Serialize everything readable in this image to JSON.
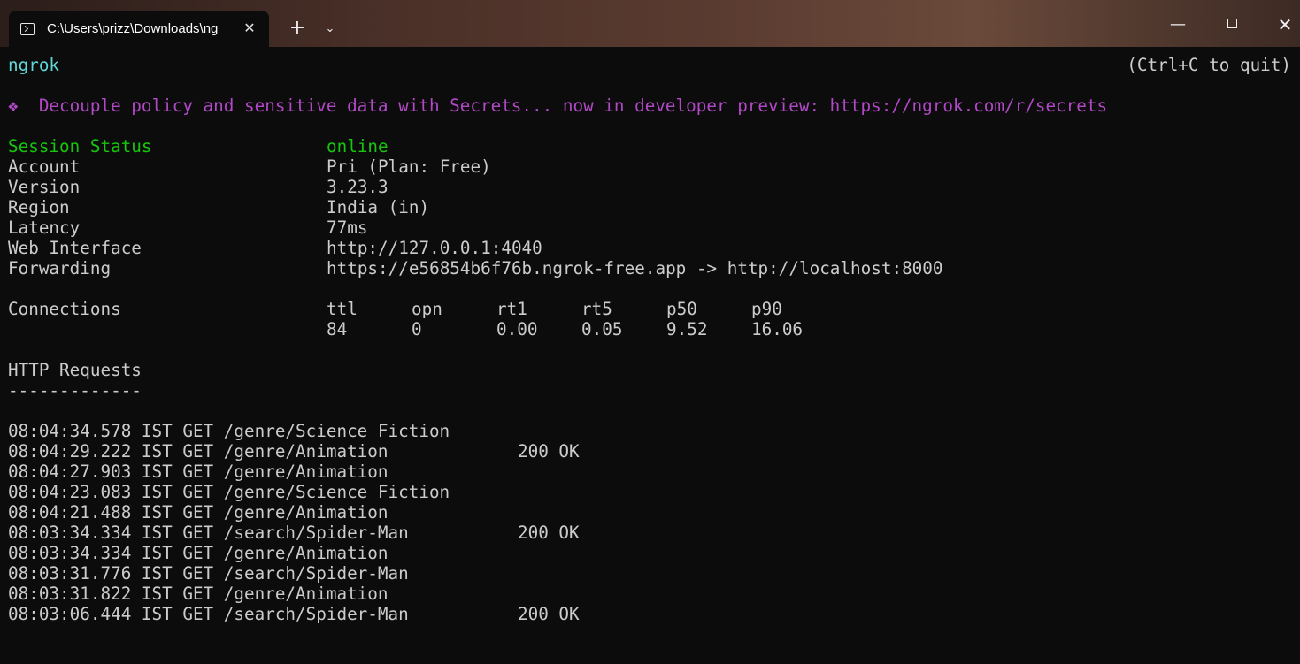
{
  "titlebar": {
    "tab_title": "C:\\Users\\prizz\\Downloads\\ng",
    "tab_close": "✕",
    "new_tab": "+",
    "dropdown": "⌄",
    "minimize": "—",
    "close": "✕"
  },
  "terminal": {
    "app_name": "ngrok",
    "quit_hint": "(Ctrl+C to quit)",
    "banner": "❖  Decouple policy and sensitive data with Secrets... now in developer preview: https://ngrok.com/r/secrets",
    "session": [
      {
        "label": "Session Status",
        "value": "online"
      },
      {
        "label": "Account",
        "value": "Pri (Plan: Free)"
      },
      {
        "label": "Version",
        "value": "3.23.3"
      },
      {
        "label": "Region",
        "value": "India (in)"
      },
      {
        "label": "Latency",
        "value": "77ms"
      },
      {
        "label": "Web Interface",
        "value": "http://127.0.0.1:4040"
      },
      {
        "label": "Forwarding",
        "value": "https://e56854b6f76b.ngrok-free.app -> http://localhost:8000"
      }
    ],
    "connections": {
      "label": "Connections",
      "headers": [
        "ttl",
        "opn",
        "rt1",
        "rt5",
        "p50",
        "p90"
      ],
      "values": [
        "84",
        "0",
        "0.00",
        "0.05",
        "9.52",
        "16.06"
      ]
    },
    "http_requests": {
      "title": "HTTP Requests",
      "underline": "-------------",
      "rows": [
        {
          "line": "08:04:34.578 IST GET /genre/Science Fiction",
          "status": ""
        },
        {
          "line": "08:04:29.222 IST GET /genre/Animation",
          "status": "200 OK"
        },
        {
          "line": "08:04:27.903 IST GET /genre/Animation",
          "status": ""
        },
        {
          "line": "08:04:23.083 IST GET /genre/Science Fiction",
          "status": ""
        },
        {
          "line": "08:04:21.488 IST GET /genre/Animation",
          "status": ""
        },
        {
          "line": "08:03:34.334 IST GET /search/Spider-Man",
          "status": "200 OK"
        },
        {
          "line": "08:03:34.334 IST GET /genre/Animation",
          "status": ""
        },
        {
          "line": "08:03:31.776 IST GET /search/Spider-Man",
          "status": ""
        },
        {
          "line": "08:03:31.822 IST GET /genre/Animation",
          "status": ""
        },
        {
          "line": "08:03:06.444 IST GET /search/Spider-Man",
          "status": "200 OK"
        }
      ]
    }
  },
  "colors": {
    "background": "#0c0c0c",
    "text": "#cccccc",
    "cyan": "#61d6d6",
    "green": "#16c60c",
    "purple": "#b148c6"
  }
}
